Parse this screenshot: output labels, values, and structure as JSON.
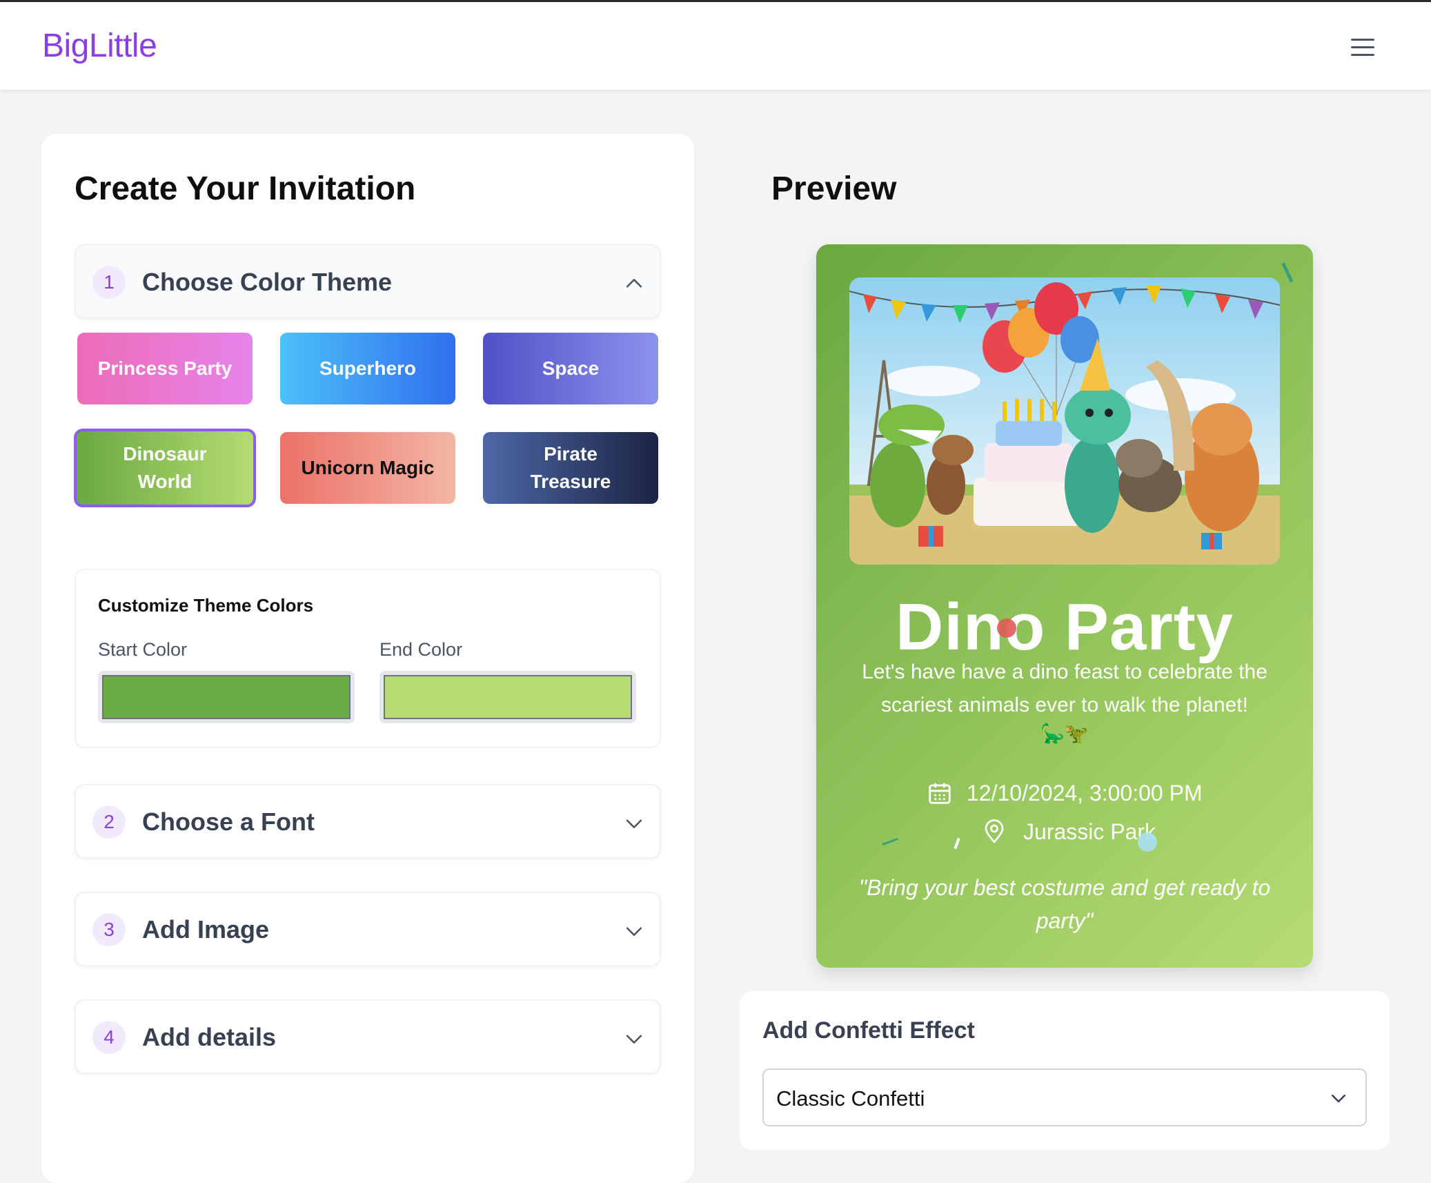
{
  "app": {
    "logo": "BigLittle"
  },
  "builder": {
    "title": "Create Your Invitation",
    "sections": [
      {
        "number": "1",
        "title": "Choose Color Theme",
        "expanded": true
      },
      {
        "number": "2",
        "title": "Choose a Font",
        "expanded": false
      },
      {
        "number": "3",
        "title": "Add Image",
        "expanded": false
      },
      {
        "number": "4",
        "title": "Add details",
        "expanded": false
      }
    ],
    "themes": [
      {
        "label": "Princess Party",
        "start": "#ec6cb7",
        "end": "#e684ea",
        "text_color": "#ffffff",
        "selected": false
      },
      {
        "label": "Superhero",
        "start": "#4cc0f8",
        "end": "#3070ee",
        "text_color": "#ffffff",
        "selected": false
      },
      {
        "label": "Space",
        "start": "#5250c6",
        "end": "#8c92ee",
        "text_color": "#ffffff",
        "selected": false
      },
      {
        "label": "Dinosaur World",
        "start": "#6aa840",
        "end": "#b5dc73",
        "text_color": "#ffffff",
        "selected": true
      },
      {
        "label": "Unicorn Magic",
        "start": "#ec7169",
        "end": "#f2b6a4",
        "text_color": "#111111",
        "selected": false
      },
      {
        "label": "Pirate Treasure",
        "start": "#4c68a6",
        "end": "#1c2443",
        "text_color": "#ffffff",
        "selected": false
      }
    ],
    "customize": {
      "title": "Customize Theme Colors",
      "start_label": "Start Color",
      "end_label": "End Color",
      "start_color": "#6aaa42",
      "end_color": "#b5dd72"
    }
  },
  "preview": {
    "title": "Preview",
    "card": {
      "title": "Dino Party",
      "description": "Let's have have a dino feast to celebrate the scariest animals ever to walk the planet!",
      "emoji": "🦕🦖",
      "datetime": "12/10/2024, 3:00:00 PM",
      "location": "Jurassic Park",
      "quote": "\"Bring your best costume and get ready to party\"",
      "icons": {
        "date": "calendar-icon",
        "location": "map-pin-icon"
      }
    }
  },
  "confetti": {
    "title": "Add Confetti Effect",
    "selected": "Classic Confetti"
  },
  "colors": {
    "brand": "#8b3fe0",
    "selection_ring": "#8b5cf6"
  }
}
